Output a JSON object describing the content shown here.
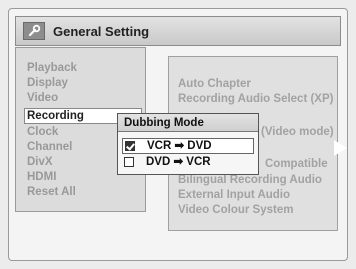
{
  "header": {
    "title": "General Setting",
    "icon": "wrench-icon"
  },
  "left_menu": {
    "items": [
      "Playback",
      "Display",
      "Video",
      "Recording",
      "Clock",
      "Channel",
      "DivX",
      "HDMI",
      "Reset All"
    ],
    "selected": "Recording"
  },
  "right_menu": {
    "items": [
      "Auto Chapter",
      "Recording Audio Select (XP)",
      "",
      "(Video mode)",
      "",
      "Compatible",
      "Bilingual Recording Audio",
      "External Input Audio",
      "Video Colour System"
    ]
  },
  "dialog": {
    "title": "Dubbing Mode",
    "options": [
      {
        "label": "VCR ➡ DVD",
        "checked": true
      },
      {
        "label": "DVD ➡ VCR",
        "checked": false
      }
    ]
  },
  "colors": {
    "panel": "#dcdcdc",
    "text_inactive": "#999999",
    "text_active": "#222222"
  }
}
